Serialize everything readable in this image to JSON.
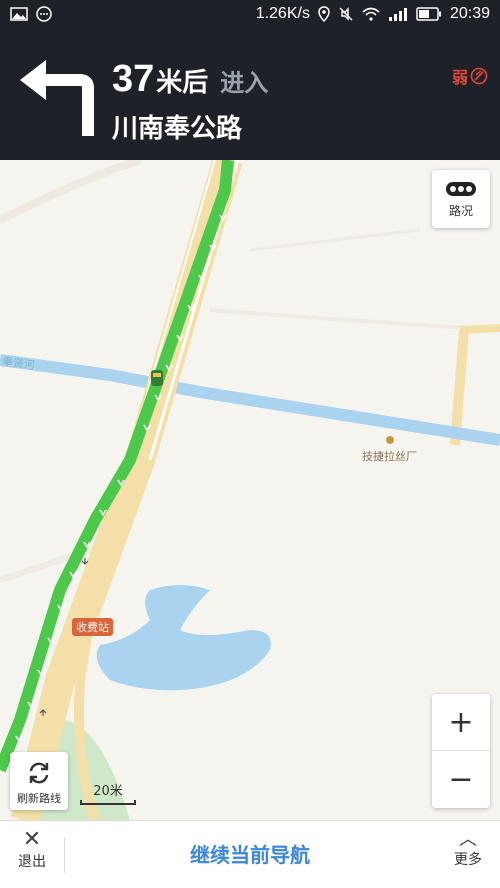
{
  "status_bar": {
    "speed": "1.26K/s",
    "time": "20:39"
  },
  "guidance": {
    "distance_value": "37",
    "distance_unit": "米后",
    "action": "进入",
    "road_name": "川南奉公路",
    "gps_signal": "弱",
    "turn_direction": "left"
  },
  "map": {
    "traffic_button": "路况",
    "poi_name": "技捷拉丝厂",
    "canal_name": "奉贤河",
    "toll_station": "收费站",
    "refresh_label": "刷新路线",
    "scale_label": "20米",
    "zoom_in": "+",
    "zoom_out": "−"
  },
  "bottom_bar": {
    "exit_label": "退出",
    "continue_label": "继续当前导航",
    "more_label": "更多"
  },
  "colors": {
    "header_bg": "#1e2228",
    "route_green": "#4cc94a",
    "road_yellow": "#f4dfa8",
    "water_blue": "#a9d3ee",
    "accent_blue": "#3c86e0"
  }
}
